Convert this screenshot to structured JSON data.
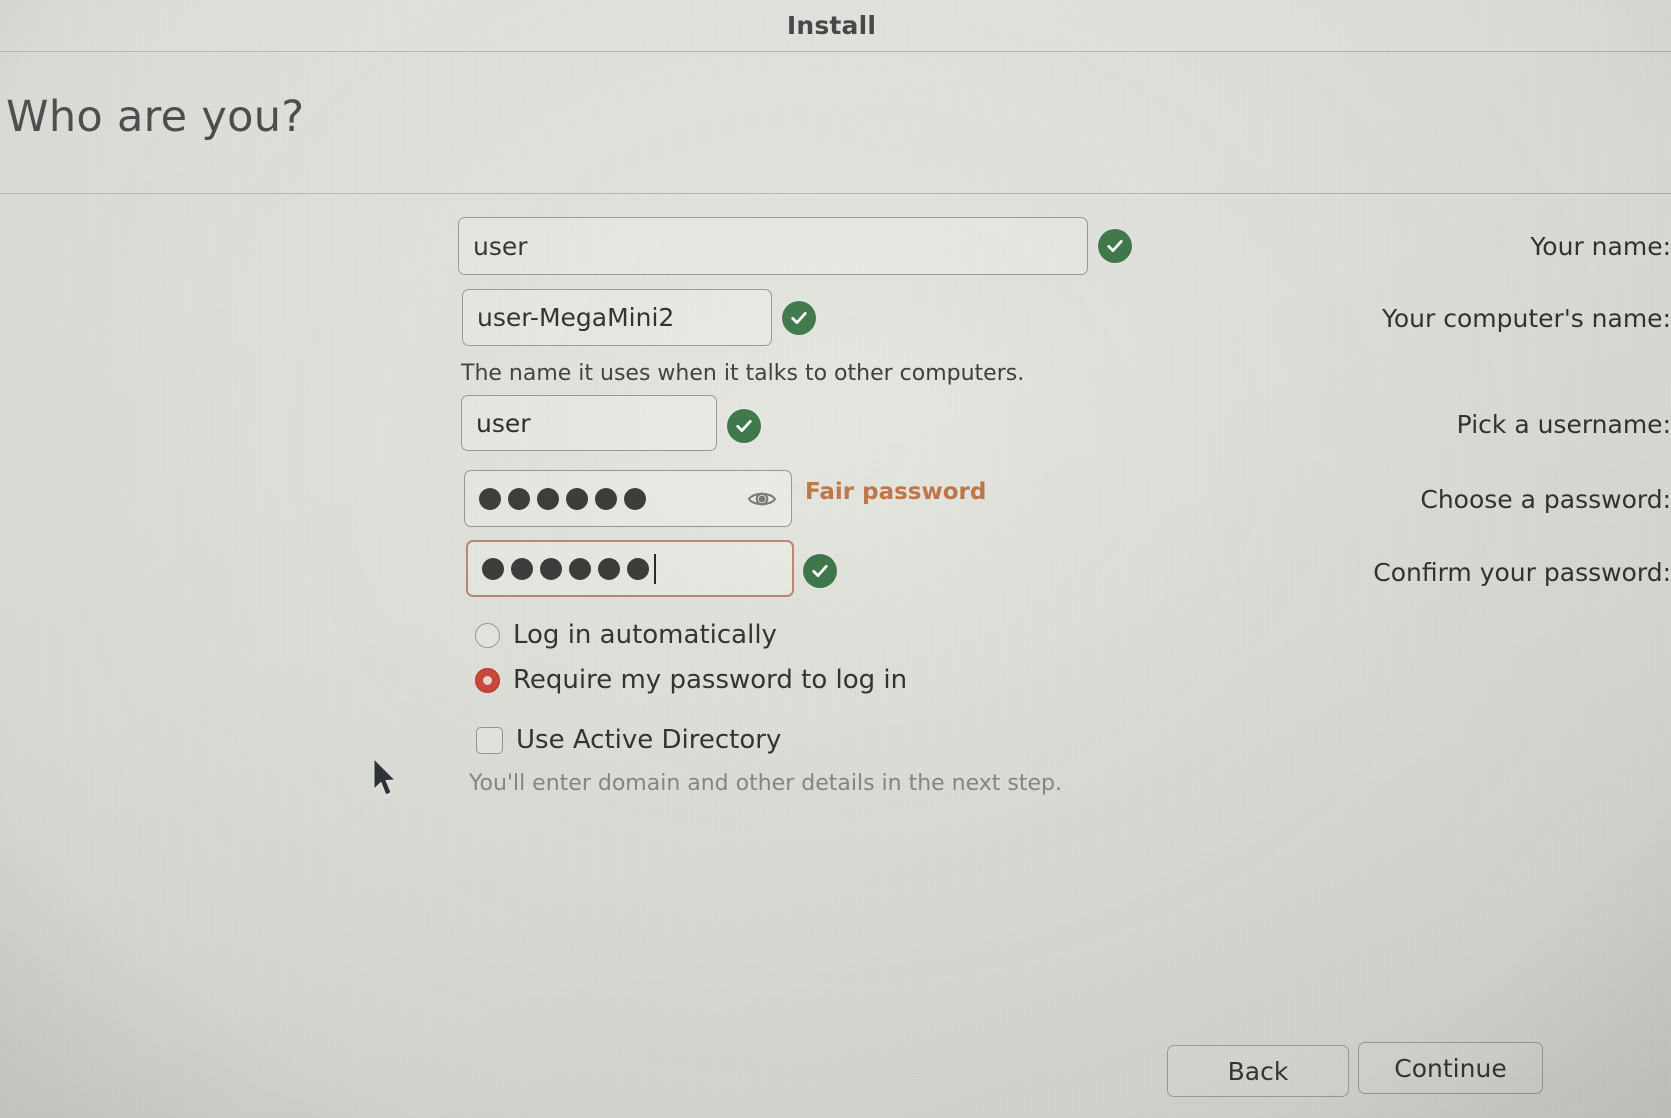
{
  "window": {
    "title": "Install"
  },
  "page": {
    "heading": "Who are you?"
  },
  "form": {
    "name": {
      "label": "Your name:",
      "value": "user",
      "valid_icon": "check-circle-icon"
    },
    "computer_name": {
      "label": "Your computer's name:",
      "value": "user-MegaMini2",
      "hint": "The name it uses when it talks to other computers.",
      "valid_icon": "check-circle-icon"
    },
    "username": {
      "label": "Pick a username:",
      "value": "user",
      "valid_icon": "check-circle-icon"
    },
    "password": {
      "label": "Choose a password:",
      "value": "••••••",
      "dots": 6,
      "reveal_icon": "eye-icon",
      "strength": "Fair password",
      "strength_color": "#c3784a"
    },
    "confirm_password": {
      "label": "Confirm your password:",
      "value": "••••••",
      "dots": 6,
      "focused": true,
      "valid_icon": "check-circle-icon"
    }
  },
  "options": {
    "login_auto": {
      "label": "Log in automatically",
      "selected": false
    },
    "require_password": {
      "label": "Require my password to log in",
      "selected": true
    },
    "active_directory": {
      "label": "Use Active Directory",
      "checked": false,
      "hint": "You'll enter domain and other details in the next step."
    }
  },
  "footer": {
    "back_label": "Back",
    "continue_label": "Continue"
  },
  "colors": {
    "background": "#e7e8e2",
    "accent_radio": "#d24b3e",
    "valid_green": "#3f7a4b",
    "focus_border": "#c08b78"
  }
}
